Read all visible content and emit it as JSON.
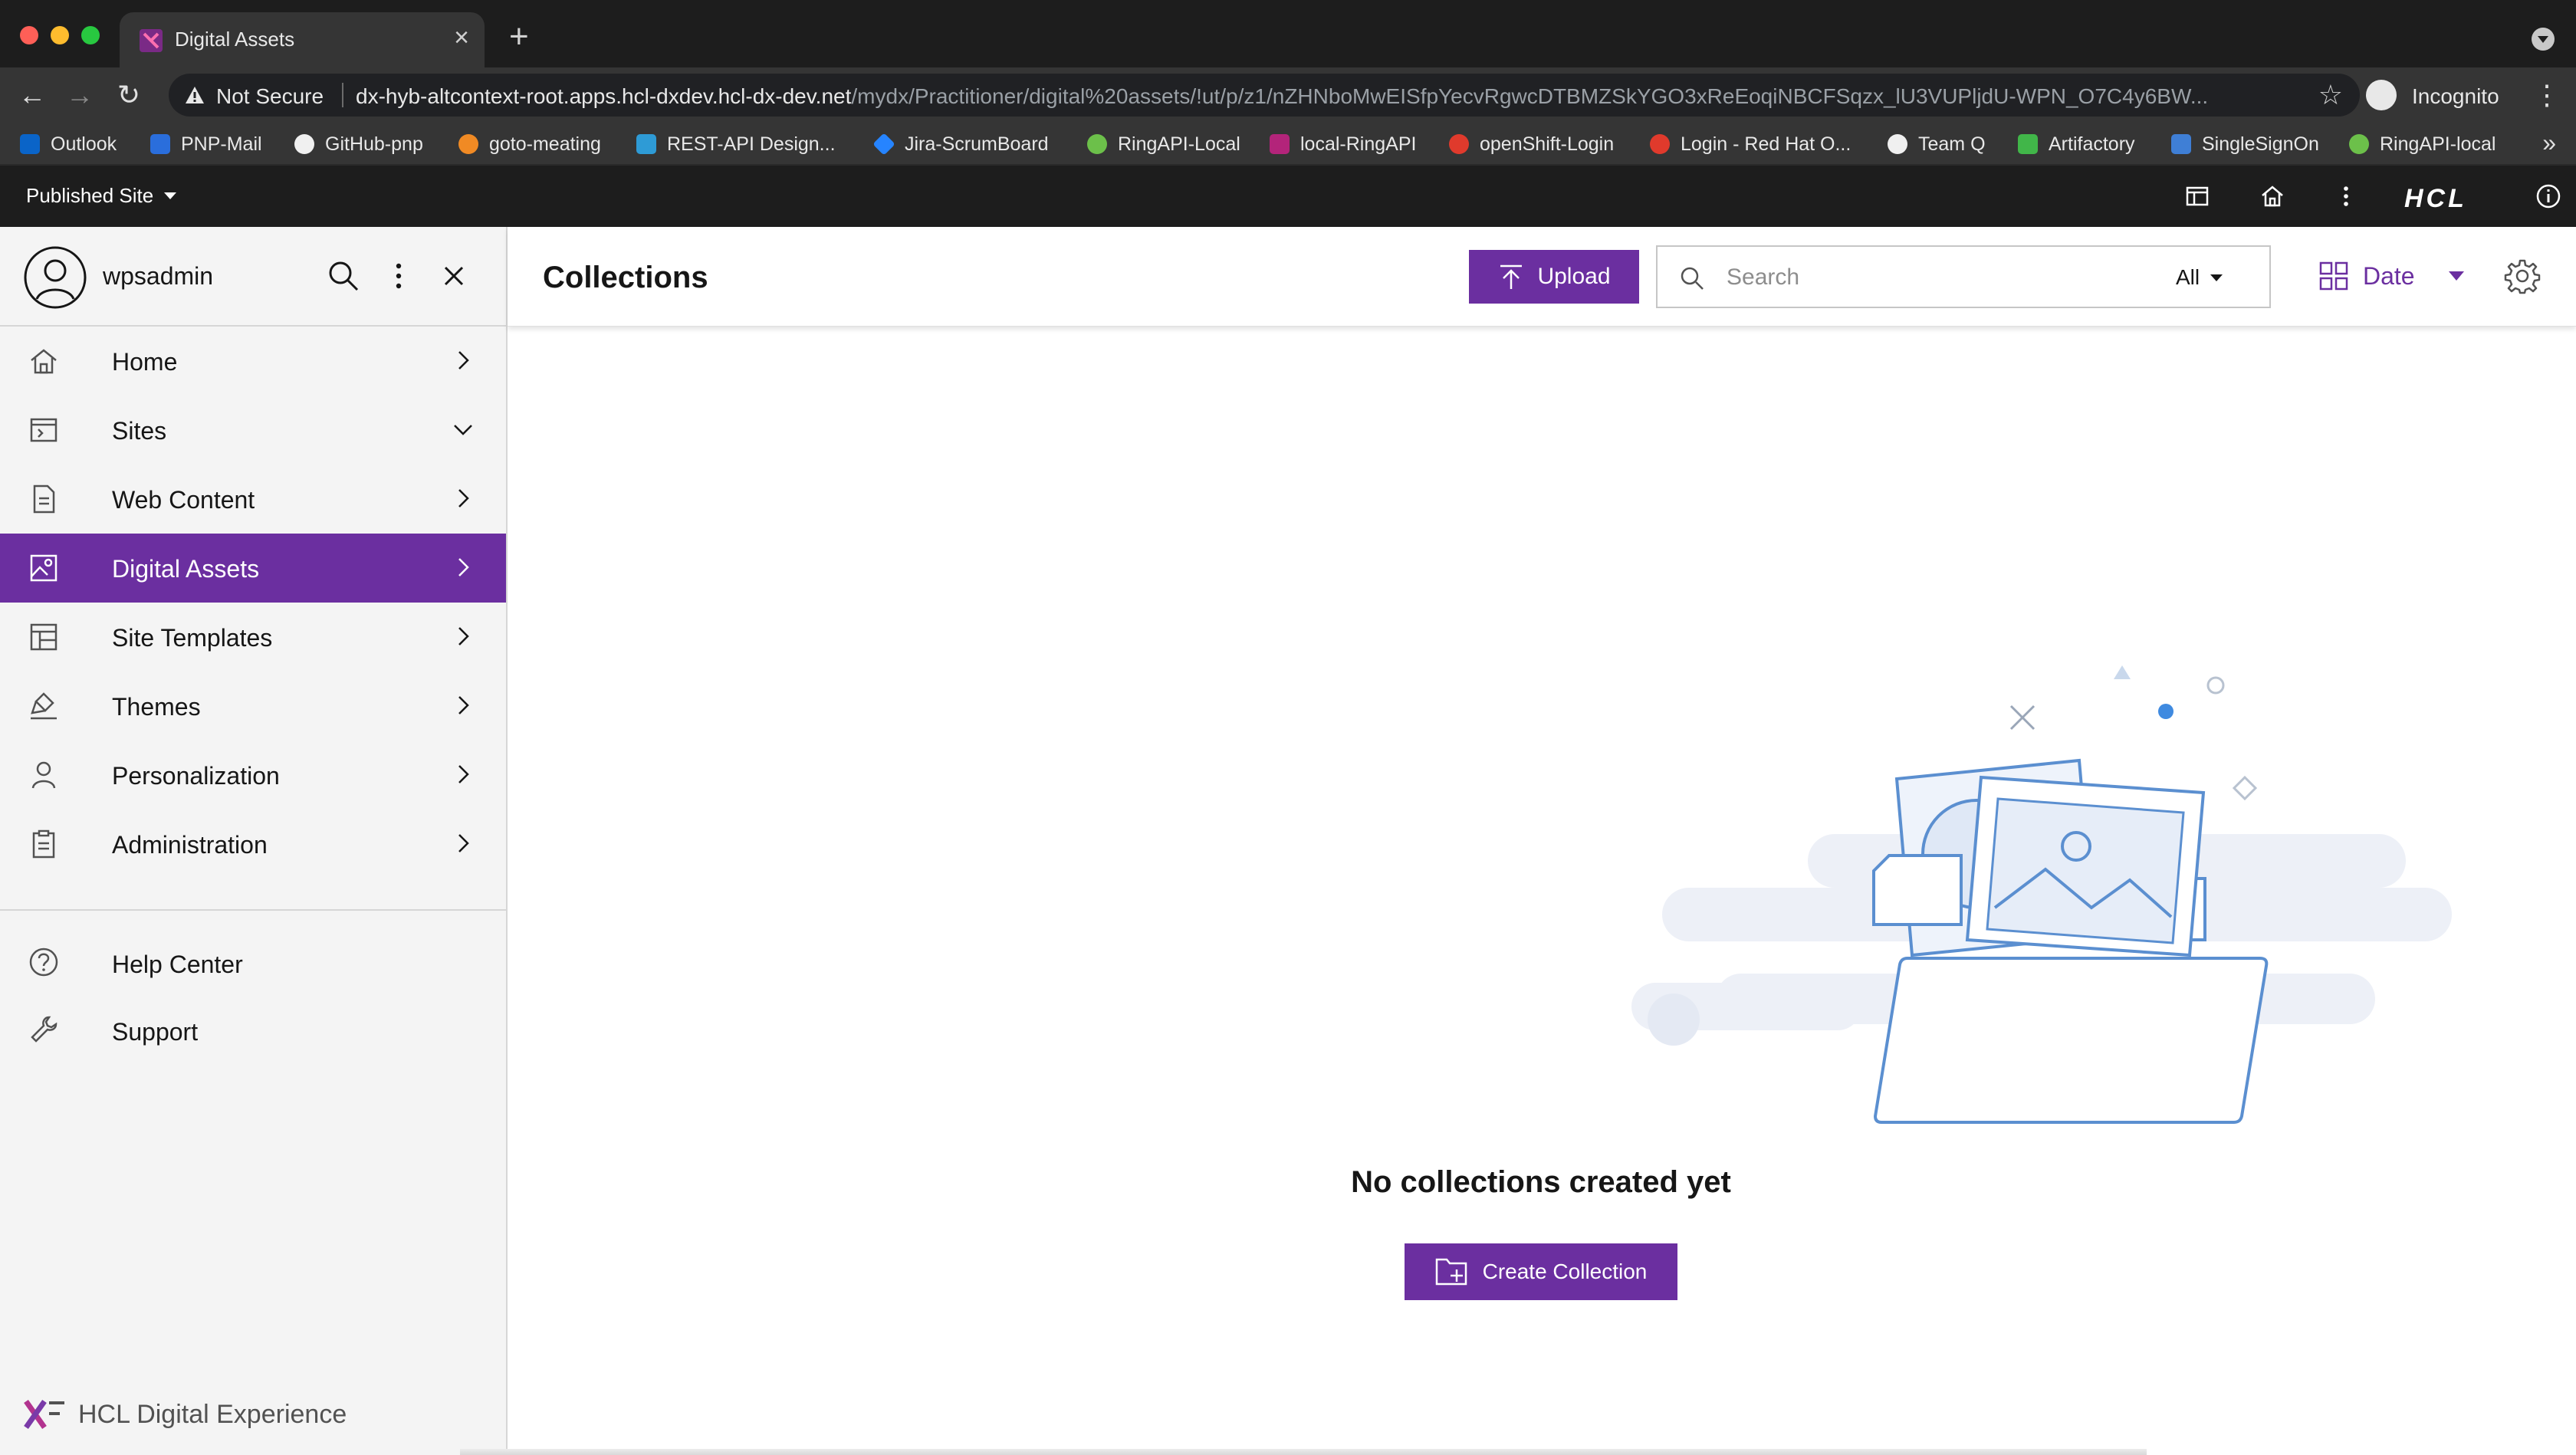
{
  "browser": {
    "tab_title": "Digital Assets",
    "security_label": "Not Secure",
    "url_host": "dx-hyb-altcontext-root.apps.hcl-dxdev.hcl-dx-dev.net",
    "url_path": "/mydx/Practitioner/digital%20assets/!ut/p/z1/nZHNboMwEISfpYecvRgwcDTBMZSkYGO3xReEoqiNBCFSqzx_lU3VUPljdU-WPN_O7C4y6BW...",
    "incognito_label": "Incognito",
    "bookmarks": [
      {
        "label": "Outlook",
        "color": "#0a64c8"
      },
      {
        "label": "PNP-Mail",
        "color": "#2a6edc"
      },
      {
        "label": "GitHub-pnp",
        "color": "#f0f0f0"
      },
      {
        "label": "goto-meating",
        "color": "#f08a24"
      },
      {
        "label": "REST-API Design...",
        "color": "#2e9bd6"
      },
      {
        "label": "Jira-ScrumBoard",
        "color": "#2684ff"
      },
      {
        "label": "RingAPI-Local",
        "color": "#6cc04a"
      },
      {
        "label": "local-RingAPI",
        "color": "#b3247a"
      },
      {
        "label": "openShift-Login",
        "color": "#e03a2c"
      },
      {
        "label": "Login - Red Hat O...",
        "color": "#e03a2c"
      },
      {
        "label": "Team Q",
        "color": "#f0f0f0"
      },
      {
        "label": "Artifactory",
        "color": "#41b649"
      },
      {
        "label": "SingleSignOn",
        "color": "#3f7fd6"
      },
      {
        "label": "RingAPI-local",
        "color": "#6cc04a"
      }
    ]
  },
  "portal_bar": {
    "site_label": "Published Site",
    "brand_logo": "HCL"
  },
  "sidebar": {
    "username": "wpsadmin",
    "nav": [
      {
        "label": "Home",
        "icon": "home-icon",
        "chevron": "right"
      },
      {
        "label": "Sites",
        "icon": "sites-icon",
        "chevron": "down"
      },
      {
        "label": "Web Content",
        "icon": "document-icon",
        "chevron": "right"
      },
      {
        "label": "Digital Assets",
        "icon": "image-icon",
        "chevron": "right",
        "active": true
      },
      {
        "label": "Site Templates",
        "icon": "template-icon",
        "chevron": "right"
      },
      {
        "label": "Themes",
        "icon": "paint-icon",
        "chevron": "right"
      },
      {
        "label": "Personalization",
        "icon": "user-icon",
        "chevron": "right"
      },
      {
        "label": "Administration",
        "icon": "clipboard-icon",
        "chevron": "right"
      }
    ],
    "help": [
      {
        "label": "Help Center",
        "icon": "help-icon"
      },
      {
        "label": "Support",
        "icon": "wrench-icon"
      }
    ],
    "brand": "HCL Digital Experience"
  },
  "main": {
    "title": "Collections",
    "upload_label": "Upload",
    "search_placeholder": "Search",
    "search_scope": "All",
    "sort_label": "Date",
    "empty_message": "No collections created yet",
    "create_label": "Create Collection"
  },
  "colors": {
    "accent": "#6b2fa0",
    "illustration_stroke": "#5b8fd0",
    "illustration_cloud": "#edf0f7"
  }
}
